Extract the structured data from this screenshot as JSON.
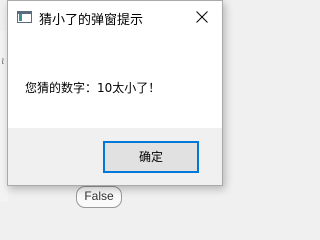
{
  "background": {
    "italic_fragment": "ι",
    "chip_label": "False"
  },
  "dialog": {
    "title": "猜小了的弹窗提示",
    "app_icon": "window-app-icon",
    "close_icon": "close-icon",
    "message": "您猜的数字：10太小了！",
    "ok_label": "确定",
    "accent_color": "#0078d7"
  }
}
